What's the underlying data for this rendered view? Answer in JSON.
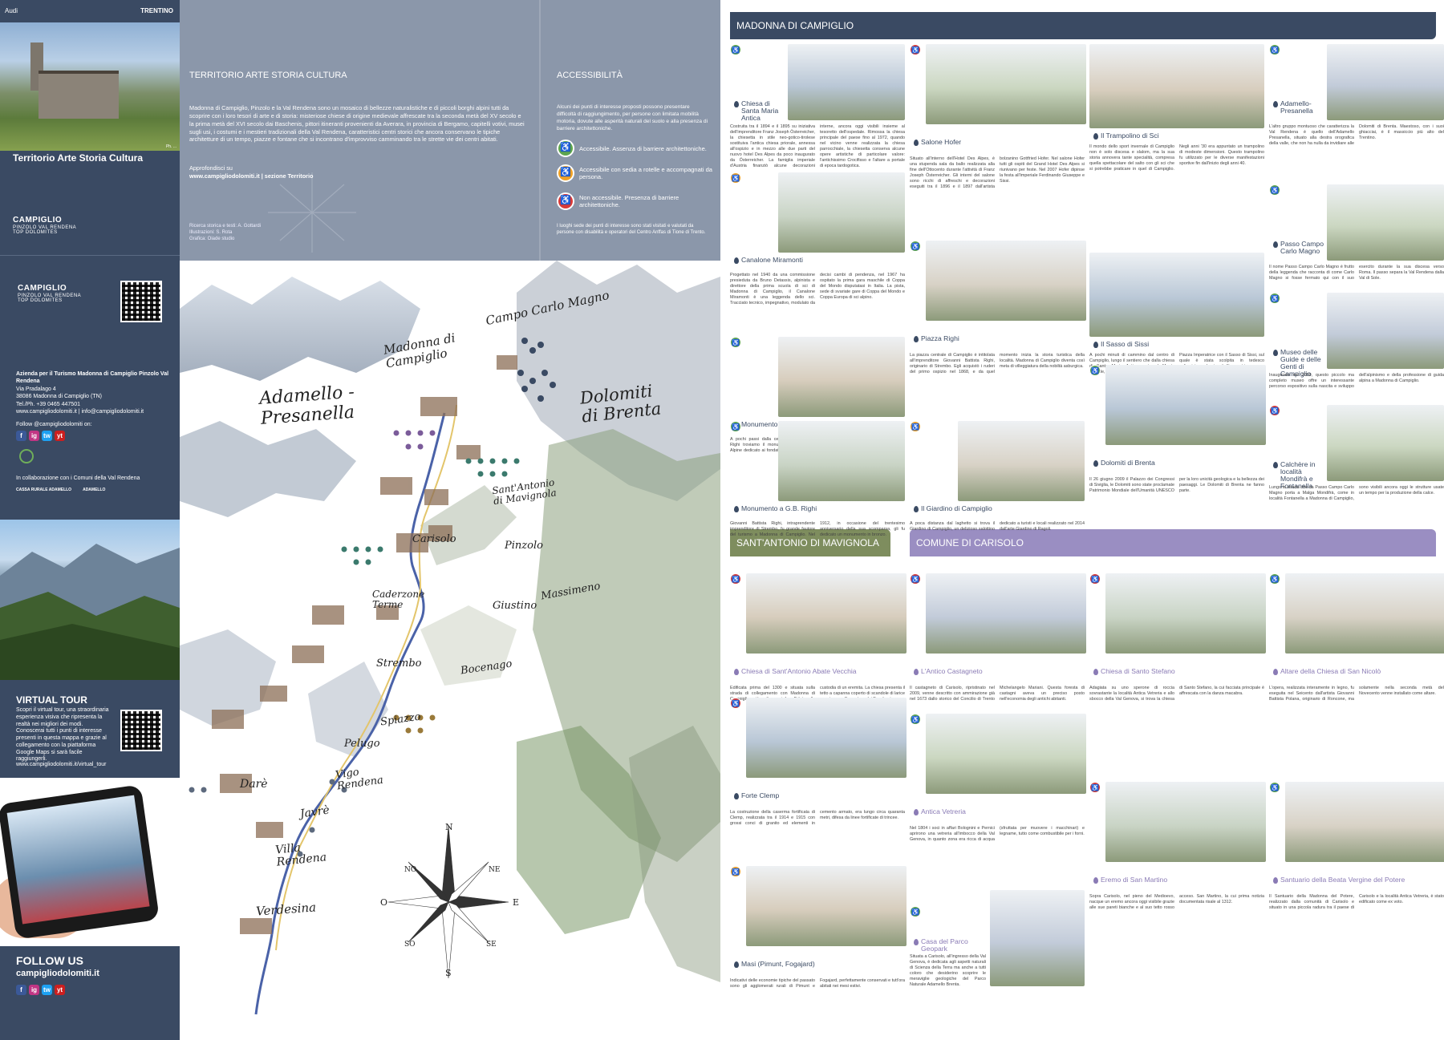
{
  "left": {
    "top_logos": [
      "Audi",
      "TRENTINO"
    ],
    "credit": "Ph. ...",
    "title": "Territorio Arte Storia Cultura",
    "logo_main": "CAMPIGLIO",
    "logo_sub": "PINZOLO VAL RENDENA",
    "logo_tag": "TOP DOLOMITES",
    "org_name": "Azienda per il Turismo Madonna di Campiglio Pinzolo Val Rendena",
    "address": "Via Pradalago 4",
    "city": "38086 Madonna di Campiglio (TN)",
    "phone": "Tel./Ph. +39 0465 447501",
    "web_email": "www.campigliodolomiti.it | info@campigliodolomiti.it",
    "follow_label": "Follow @campigliodolomiti on:",
    "collab": "In collaborazione con i Comuni della Val Rendena",
    "partner1": "CASSA RURALE ADAMELLO",
    "partner2": "ADAMELLO",
    "vt_title": "VIRTUAL TOUR",
    "vt_text": "Scopri il virtual tour, una straordinaria esperienza visiva che ripresenta la realtà nei migliori dei modi. Conoscerai tutti i punti di interesse presenti in questa mappa e grazie al collegamento con la piattaforma Google Maps si sarà facile raggiungerli.",
    "vt_url": "www.campigliodolomiti.it/virtual_tour",
    "follow_title": "FOLLOW US",
    "follow_url": "campigliodolomiti.it",
    "social": [
      "f",
      "ig",
      "tw",
      "yt"
    ]
  },
  "toppanel": {
    "heading": "TERRITORIO ARTE STORIA CULTURA",
    "body": "Madonna di Campiglio, Pinzolo e la Val Rendena sono un mosaico di bellezze naturalistiche e di piccoli borghi alpini tutti da scoprire con i loro tesori di arte e di storia: misteriose chiese di origine medievale affrescate tra la seconda metà del XV secolo e la prima metà del XVI secolo dai Baschenis, pittori itineranti provenienti da Averara, in provincia di Bergamo, capitelli votivi, musei sugli usi, i costumi e i mestieri tradizionali della Val Rendena, caratteristici centri storici che ancora conservano le tipiche architetture di un tempo, piazze e fontane che si incontrano d'improvviso camminando tra le strette vie dei centri abitati.",
    "link_label": "Approfondisci su",
    "link": "www.campigliodolomiti.it | sezione Territorio",
    "credits": [
      "Ricerca storica e testi: A. Gottardi",
      "Illustrazioni: S. Rota",
      "Grafica: Oiade studio"
    ],
    "acc_heading": "ACCESSIBILITÀ",
    "acc_body": "Alcuni dei punti di interesse proposti possono presentare difficoltà di raggiungimento, per persone con limitata mobilità motoria, dovute alle asperità naturali del suolo e alla presenza di barriere architettoniche.",
    "acc_green": "Accessibile. Assenza di barriere architettoniche.",
    "acc_orange": "Accessibile con sedia a rotelle e accompagnati da persona.",
    "acc_red": "Non accessibile. Presenza di barriere architettoniche.",
    "acc_note": "I luoghi sede dei punti di interesse sono stati visitati e valutati da persone con disabilità e operatori del Centro Anffas di Tione di Trento."
  },
  "map": {
    "labels": {
      "campo": "Campo Carlo Magno",
      "madonna": "Madonna di Campiglio",
      "adamello": "Adamello - Presanella",
      "dolomiti": "Dolomiti di Brenta",
      "santantonio": "Sant'Antonio di Mavignola",
      "carisolo": "Carisolo",
      "pinzolo": "Pinzolo",
      "caderzone": "Caderzone Terme",
      "massimeno": "Massimeno",
      "giustino": "Giustino",
      "strembo": "Strembo",
      "bocenago": "Bocenago",
      "spiazzo": "Spiazzo",
      "pelugo": "Pelugo",
      "vigo": "Vigo Rendena",
      "dare": "Darè",
      "javre": "Javrè",
      "villa": "Villa Rendena",
      "verdesina": "Verdesina"
    },
    "compass": [
      "N",
      "NE",
      "E",
      "SE",
      "S",
      "SO",
      "O",
      "NO"
    ]
  },
  "sections": {
    "madonna": "MADONNA DI CAMPIGLIO",
    "santantonio": "SANT'ANTONIO DI MAVIGNOLA",
    "carisolo": "COMUNE DI CARISOLO"
  },
  "cards": [
    {
      "title": "Chiesa di Santa Maria Antica",
      "acc": "g",
      "text": "Costruita tra il 1894 e il 1895 su iniziativa dell'imprenditore Franz Joseph Österreicher, la chiesetta in stile neo-gotico-tirolese sostituiva l'antica chiesa priorale, annessa all'ospizio e in mezzo alle due parti del nuovo hotel Des Alpes da poco inaugurato da Österreicher. La famiglia imperiale d'Austria finanziò alcune decorazioni interne, ancora oggi visibili insieme al tesoretto dell'ospedale. Rimossa la chiesa principale del paese fino al 1972, quando nel vicino venne realizzata la chiesa parrocchiale, la chiesetta conserva alcune opere artistiche di particolare valore: l'antichissimo Crocifisso e l'altare a portale di epoca tardogotica."
    },
    {
      "title": "Salone Hofer",
      "acc": "r",
      "text": "Situato all'interno dell'Hotel Des Alpes, è una stupenda sala da ballo realizzata alla fine dell'Ottocento durante l'attività di Franz Joseph Österreicher. Gli interni del salone sono ricchi di affreschi e decorazioni eseguiti tra il 1896 e il 1897 dall'artista bolzanino Gottfried Hofer. Nel salone Hofer tutti gli ospiti del Grand Hotel Des Alpes si riunivano per feste. Nel 2007 Hofer dipinse la festa all'imperiale Ferdinando Giuseppe e Sissi."
    },
    {
      "title": "Il Trampolino di Sci",
      "acc": "r",
      "text": "Il mondo dello sport invernale di Campiglio non è solo discesa e slalom, ma la sua storia annovera tante specialità, compresa quella spettacolare del salto con gli sci che si potrebbe praticare in quel di Campiglio. Negli anni '30 era appuntato un trampolino di modeste dimensioni. Questo trampolino fu utilizzato per le diverse manifestazioni sportive fin dall'inizio degli anni 40."
    },
    {
      "title": "Adamello-Presanella",
      "acc": "g",
      "text": "L'altro gruppo montuoso che caratterizza la Val Rendena è quello dell'Adamello Presanella, situato alla destra orografica della valle, che non ha nulla da invidiare alle Dolomiti di Brenta. Maestoso, con i suoi ghiacciai, è il massiccio più alto del Trentino."
    },
    {
      "title": "Canalone Miramonti",
      "acc": "o",
      "text": "Progettato nel 1940 da una commissione presieduta da Bruno Detassis, alpinista e direttore della prima scuola di sci di Madonna di Campiglio, il Canalone Miramonti è una leggenda dello sci. Tracciato tecnico, impegnativo, modulato da decisi cambi di pendenza, nel 1967 ha ospitato la prima gara maschile di Coppa del Mondo disputatasi in Italia. La pista, sede di svariate gare di Coppa del Mondo e Coppa Europa di sci alpino."
    },
    {
      "title": "Piazza Righi",
      "acc": "g",
      "text": "La piazza centrale di Campiglio è intitolata all'imprenditore Giovanni Battista Righi, originario di Strembo. Egli acquistò i ruderi del primo ospizio nel 1868, e da quel momento inizia la storia turistica della località. Madonna di Campiglio diventa così meta di villeggiatura della nobiltà asburgica."
    },
    {
      "title": "Il Sasso di Sissi",
      "acc": "r",
      "text": "A pochi minuti di cammino dal centro di Campiglio, lungo il sentiero che dalla chiesa di Santa Maria Antica porta al Monte Spinale, troviamo la piccola e panoramica Piazza Imperatrice con il Sasso di Sissi, sul quale è stata scolpita in tedesco un'iscrizione che ricorda l'imperatrice."
    },
    {
      "title": "Passo Campo Carlo Magno",
      "acc": "g",
      "text": "Il nome Passo Campo Carlo Magno è frutto della leggenda che racconta di come Carlo Magno si fosse fermato qui con il suo esercito durante la sua discesa verso Roma. Il passo separa la Val Rendena dalla Val di Sole."
    },
    {
      "title": "Monumento alle Guide Alpine",
      "acc": "g",
      "text": "A pochi passi dalla centralissima Piazza Righi troviamo il monumento alle Guide Alpine dedicato ai fondatori Bruno Detassis e alle guide che fecero grande la storia dell'alpinismo sulle Dolomiti di Brenta."
    },
    {
      "title": "Museo delle Guide e delle Genti di Campiglio",
      "acc": "g",
      "text": "Inaugurato nel 2009, questo piccolo ma completo museo offre un interessante percorso espositivo sulla nascita e sviluppo dell'alpinismo e della professione di guida alpina a Madonna di Campiglio."
    },
    {
      "title": "Monumento a G.B. Righi",
      "acc": "g",
      "text": "Giovanni Battista Righi, intraprendente imprenditore di Strembo, fu grande fautore del turismo a Madonna di Campiglio. Nel 1912, in occasione del trentesimo anniversario della sua scomparsa, gli fu dedicato un monumento in bronzo."
    },
    {
      "title": "Il Giardino di Campiglio",
      "acc": "o",
      "text": "A poca distanza dal laghetto si trova il Giardino di Campiglio, un delizioso salottino dedicato a turisti e locali realizzato nel 2014 dall'arte Giardino di Ragoli."
    },
    {
      "title": "Dolomiti di Brenta",
      "acc": "g",
      "text": "Il 26 giugno 2009 il Palazzo dei Congressi di Siviglia, le Dolomiti sono state proclamate Patrimonio Mondiale dell'Umanità UNESCO per la loro unicità geologica e la bellezza dei paesaggi. Le Dolomiti di Brenta ne fanno parte."
    },
    {
      "title": "Calchère in località Mondifrà e Fontanella",
      "acc": "r",
      "text": "Lungo la strada che da Passo Campo Carlo Magno porta a Malga Mondifrà, come in località Fontanella a Madonna di Campiglio, sono visibili ancora oggi le strutture usate un tempo per la produzione della calce."
    },
    {
      "title": "Chiesa di Sant'Antonio Abate Vecchia",
      "acc": "r",
      "text": "Edificata prima del 1300 e situata sulla strada di collegamento con Madonna di Campiglio, più volte anni fu affidata alla custodia di un eremita. La chiesa presenta il tetto a capanna coperto di scandole di larice e varie sue affrescature dei Baschenis."
    },
    {
      "title": "L'Antico Castagneto",
      "acc": "r",
      "text": "Il castagneto di Carisolo, ripristinato nel 2009, venne descritto con ammirazione già nel 1673 dallo storico del Concilio di Trento Michelangelo Mariani. Questa foresta di castagni aveva un preciso posto nell'economia degli antichi abitanti."
    },
    {
      "title": "Chiesa di Santo Stefano",
      "acc": "r",
      "text": "Adagiata su uno sperone di roccia sovrastante la località Antica Vetreria e allo sbocco della Val Genova, si trova la chiesa di Santo Stefano, la cui facciata principale è affrescata con la danza macabra."
    },
    {
      "title": "Altare della Chiesa di San Nicolò",
      "acc": "g",
      "text": "L'opera, realizzata interamente in legno, fu eseguita nel Seicento dall'artista Giovanni Battista Polana, originario di Roncone, ma solamente nella seconda metà del Novecento venne installato come altare."
    },
    {
      "title": "Forte Clemp",
      "acc": "r",
      "text": "La costruzione della caserma fortificata di Clemp, realizzata tra il 1914 e 1915 con grossi conci di granito ed elementi in cemento armato, era lungo circa quaranta metri, difesa da linee fortificate di trincee."
    },
    {
      "title": "Antica Vetreria",
      "acc": "g",
      "text": "Nel 1804 i soci in affari Bolognini e Pernici aprirono una vetreria all'imbocco della Val Genova, in quanto zona era ricca di acqua (sfruttata per muovere i macchinari) e legname, tutto come combustibile per i forni."
    },
    {
      "title": "Masi (Pimunt, Fogajard)",
      "acc": "o",
      "text": "Indicativi delle economie tipiche del passato sono gli agglomerati rurali di Pimunt e Fogajard, perfettamente conservati e tutt'ora abitati nei mesi estivi."
    },
    {
      "title": "Casa del Parco Geopark",
      "acc": "g",
      "text": "Situata a Carisolo, all'ingresso della Val Genova, è dedicata agli aspetti naturali di Scienza della Terra ma anche a tutti coloro che desiderino scoprire le meraviglie geologiche del Parco Naturale Adamello Brenta."
    },
    {
      "title": "Eremo di San Martino",
      "acc": "r",
      "text": "Sopra Carisolo, nel pieno del Medioevo, nacque un eremo ancora oggi visibile grazie alle sue pareti bianche e al suo tetto rosso acceso. San Martino, la cui prima notizia documentata risale al 1312."
    },
    {
      "title": "Santuario della Beata Vergine del Potere",
      "acc": "g",
      "text": "Il Santuario della Madonna del Potere, realizzato dalla comunità di Carisolo e situato in una piccola radura tra il paese di Carisolo e la località Antica Vetreria, è stato edificato come ex voto."
    }
  ]
}
